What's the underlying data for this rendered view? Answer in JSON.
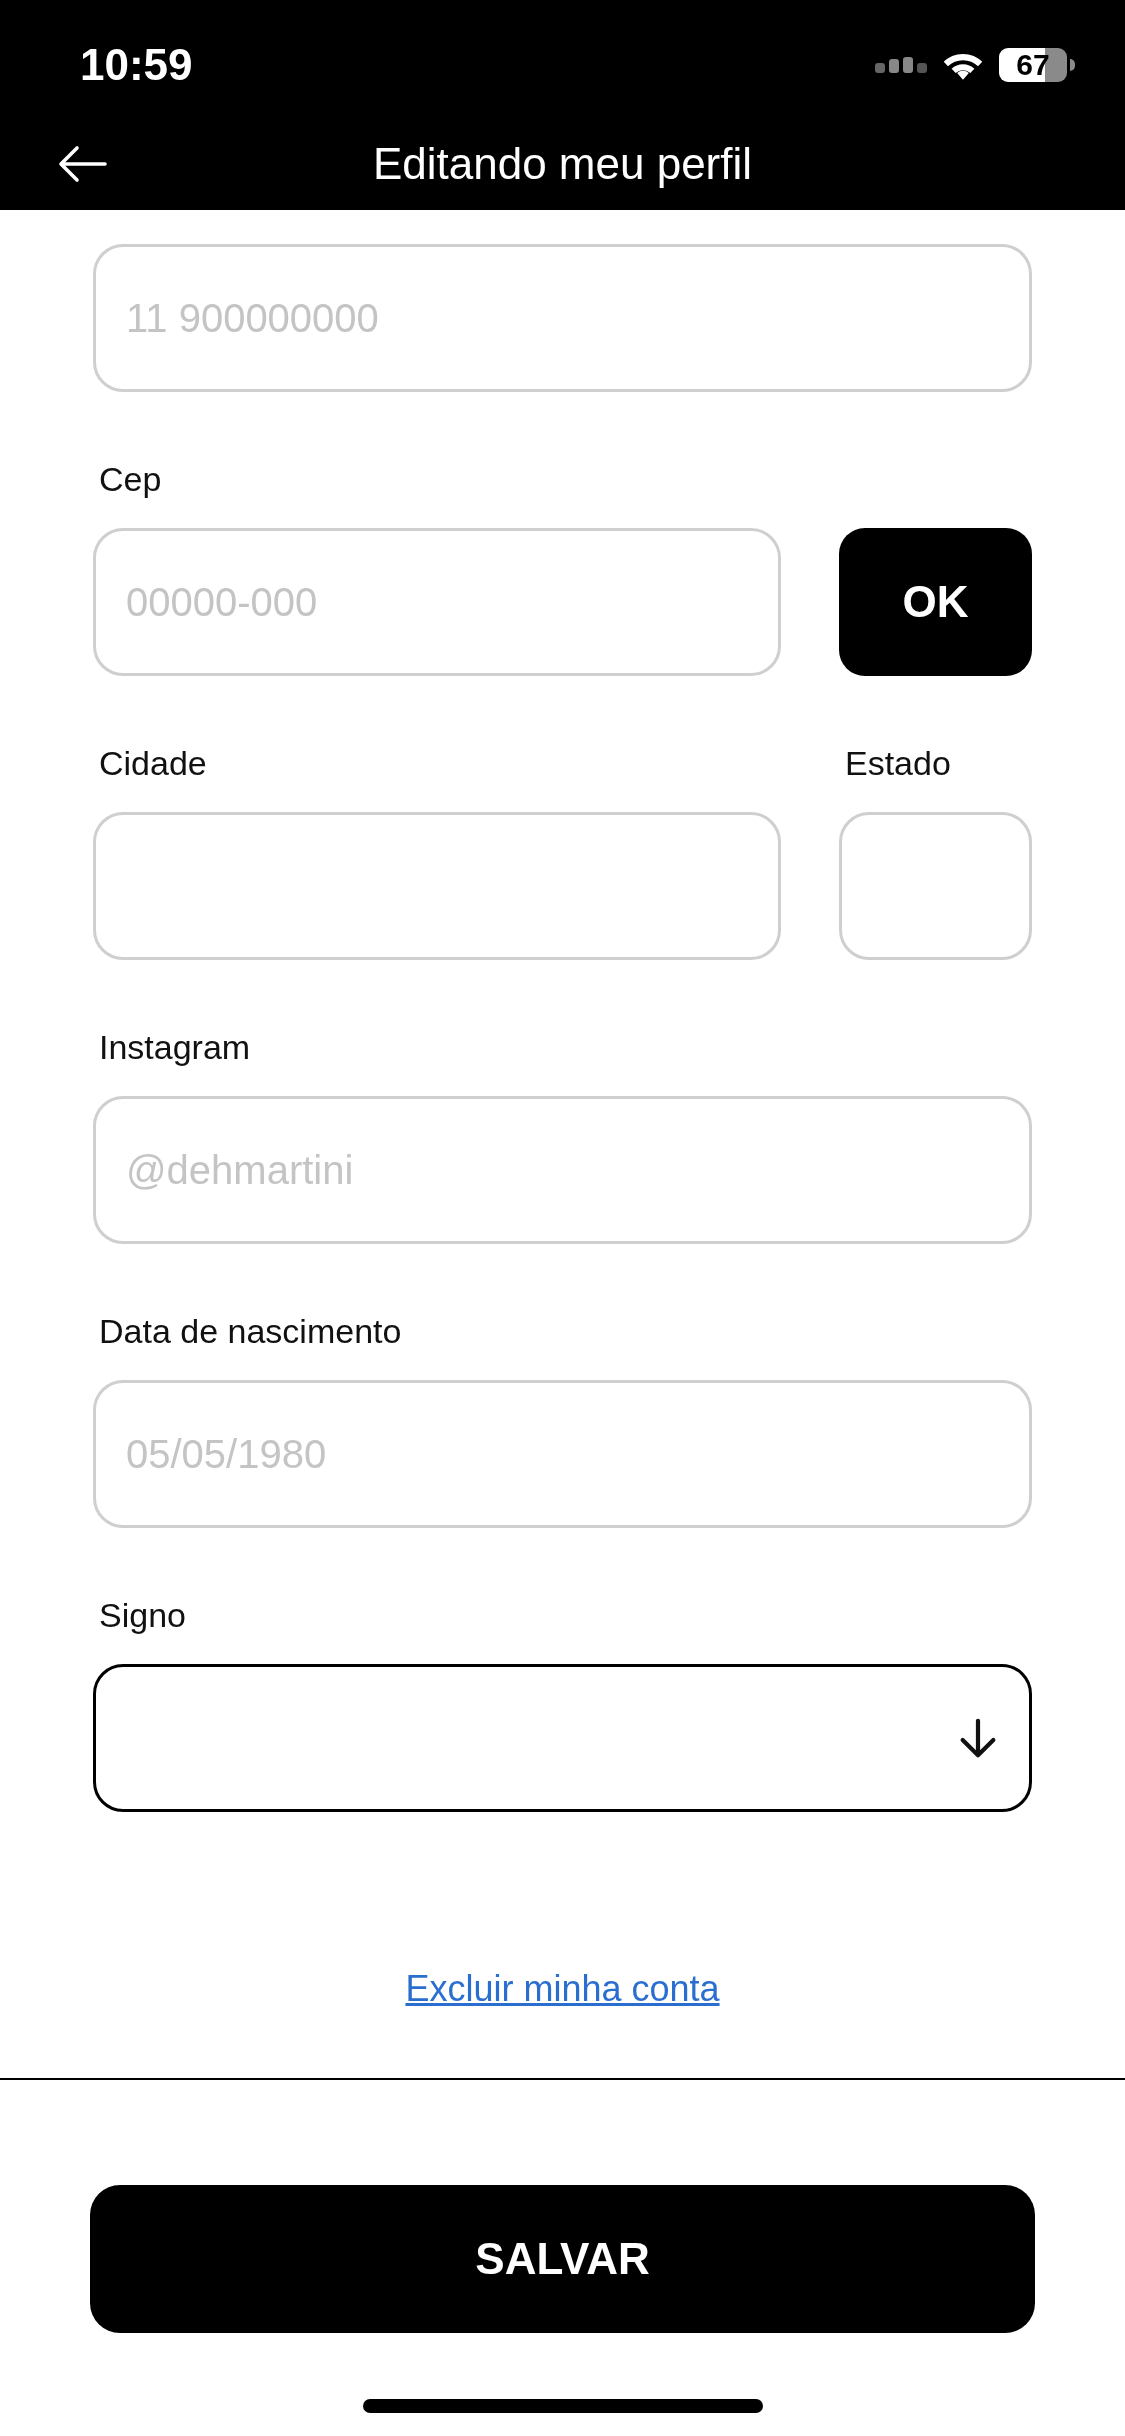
{
  "status_bar": {
    "time": "10:59",
    "battery": "67"
  },
  "header": {
    "title": "Editando meu perfil"
  },
  "form": [
    {
      "kind": "input",
      "placeholder": "11 900000000"
    },
    {
      "kind": "input_button",
      "label": "Cep",
      "placeholder": "00000-000",
      "button": "OK"
    },
    {
      "kind": "pair",
      "fields": [
        {
          "label": "Cidade"
        },
        {
          "label": "Estado"
        }
      ]
    },
    {
      "kind": "input",
      "label": "Instagram",
      "placeholder": "@dehmartini"
    },
    {
      "kind": "input",
      "label": "Data de nascimento",
      "placeholder": "05/05/1980"
    },
    {
      "kind": "select",
      "label": "Signo"
    }
  ],
  "delete_link": "Excluir minha conta",
  "save_button": "SALVAR"
}
